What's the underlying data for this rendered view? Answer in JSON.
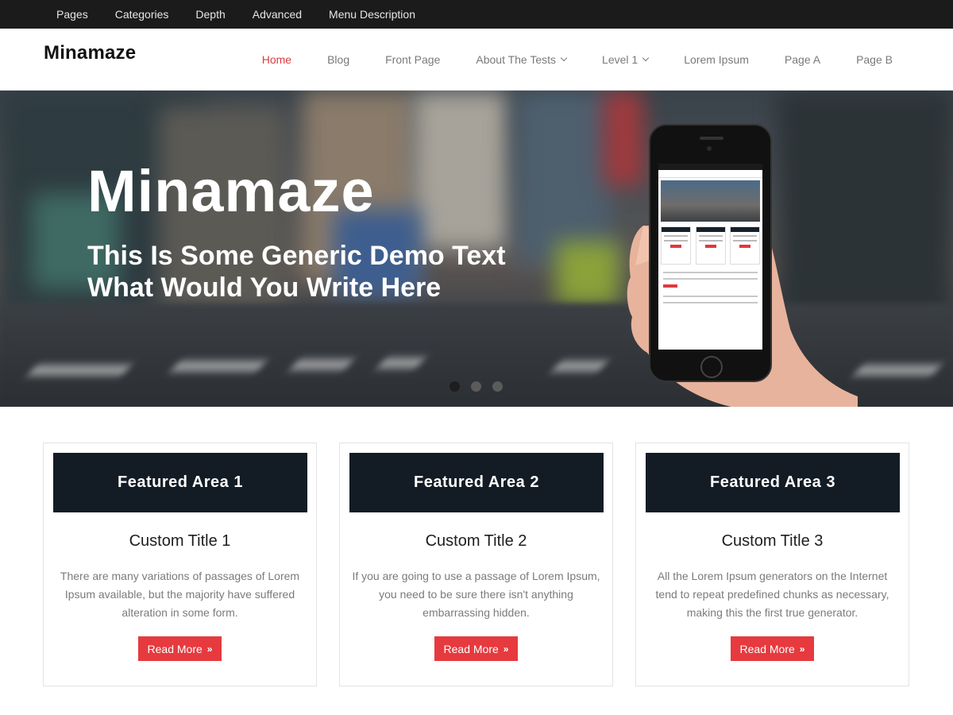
{
  "topbar": {
    "items": [
      "Pages",
      "Categories",
      "Depth",
      "Advanced",
      "Menu Description"
    ]
  },
  "header": {
    "logo": "Minamaze",
    "nav": [
      {
        "label": "Home",
        "active": true,
        "dropdown": false
      },
      {
        "label": "Blog",
        "active": false,
        "dropdown": false
      },
      {
        "label": "Front Page",
        "active": false,
        "dropdown": false
      },
      {
        "label": "About The Tests",
        "active": false,
        "dropdown": true
      },
      {
        "label": "Level 1",
        "active": false,
        "dropdown": true
      },
      {
        "label": "Lorem Ipsum",
        "active": false,
        "dropdown": false
      },
      {
        "label": "Page A",
        "active": false,
        "dropdown": false
      },
      {
        "label": "Page B",
        "active": false,
        "dropdown": false
      }
    ]
  },
  "hero": {
    "title": "Minamaze",
    "subtitle_line1": "This Is Some Generic Demo Text",
    "subtitle_line2": "What Would You Write Here",
    "slides_total": 3,
    "slide_active": 1
  },
  "features": [
    {
      "banner": "Featured Area 1",
      "title": "Custom Title 1",
      "text": "There are many variations of passages of Lorem Ipsum available, but the majority have suffered alteration in some form.",
      "button": "Read More"
    },
    {
      "banner": "Featured Area 2",
      "title": "Custom Title 2",
      "text": "If you are going to use a passage of Lorem Ipsum, you need to be sure there isn't anything embarrassing hidden.",
      "button": "Read More"
    },
    {
      "banner": "Featured Area 3",
      "title": "Custom Title 3",
      "text": "All the Lorem Ipsum generators on the Internet tend to repeat predefined chunks as necessary, making this the first true generator.",
      "button": "Read More"
    }
  ],
  "colors": {
    "accent": "#e63a3f",
    "topbar": "#1b1b1b",
    "banner": "#131c25",
    "nav_text": "#7a7a7a"
  },
  "icons": {
    "dropdown": "chevron-down-icon",
    "read_more": "double-chevron-right-icon"
  }
}
